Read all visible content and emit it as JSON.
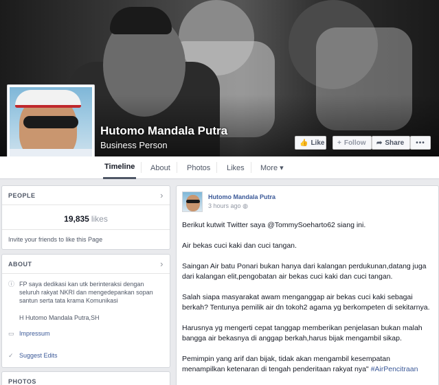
{
  "page": {
    "name": "Hutomo Mandala Putra",
    "category": "Business Person"
  },
  "actions": {
    "like": "Like",
    "follow": "Follow",
    "share": "Share",
    "more": "•••"
  },
  "nav": {
    "timeline": "Timeline",
    "about": "About",
    "photos": "Photos",
    "likes": "Likes",
    "more": "More ▾"
  },
  "people": {
    "heading": "PEOPLE",
    "likes_count": "19,835",
    "likes_label": "likes",
    "invite": "Invite your friends to like this Page"
  },
  "about": {
    "heading": "ABOUT",
    "description": "FP saya dedikasi kan utk berinteraksi dengan seluruh rakyat NKRI dan mengedepankan sopan santun serta tata krama Komunikasi",
    "signature": "H Hutomo Mandala Putra,SH",
    "impressum": "Impressum",
    "suggest_edits": "Suggest Edits"
  },
  "photos": {
    "heading": "PHOTOS"
  },
  "post": {
    "author": "Hutomo Mandala Putra",
    "time": "3 hours ago",
    "p1": "Berikut kutwit Twitter saya @TommySoeharto62 siang ini.",
    "p2": "Air bekas cuci kaki dan cuci tangan.",
    "p3": "Saingan Air batu Ponari bukan hanya dari kalangan perdukunan,datang juga dari kalangan elit,pengobatan air bekas cuci kaki dan cuci tangan.",
    "p4": "Salah siapa masyarakat awam menganggap air bekas cuci kaki sebagai berkah? Tentunya pemilik air dn tokoh2 agama yg berkompeten di sekitarnya.",
    "p5": "Harusnya yg mengerti cepat tanggap memberikan penjelasan bukan malah bangga air bekasnya di anggap berkah,harus bijak mengambil sikap.",
    "p6": "Pemimpin yang arif dan bijak, tidak akan mengambil kesempatan menampilkan ketenaran di tengah penderitaan rakyat nya\"",
    "hashtag": "#AirPencitraan"
  },
  "colors": {
    "link": "#3b5998",
    "background": "#e9eaed"
  }
}
